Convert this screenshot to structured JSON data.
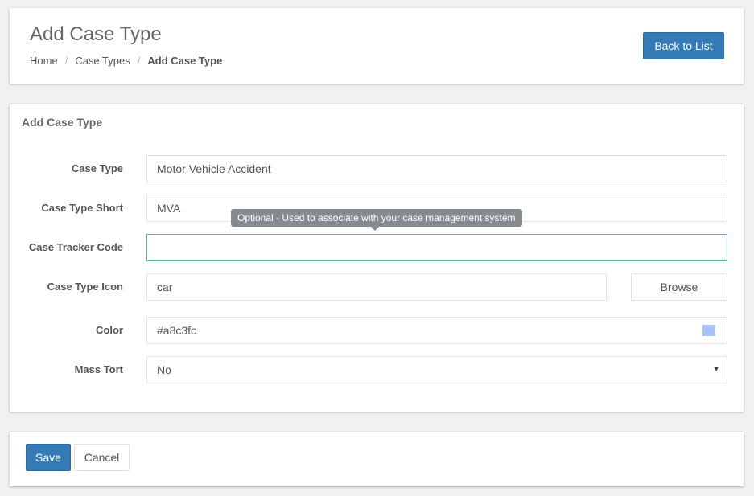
{
  "header": {
    "title": "Add Case Type",
    "back_label": "Back to List",
    "breadcrumb": [
      "Home",
      "Case Types",
      "Add Case Type"
    ]
  },
  "form": {
    "title": "Add Case Type",
    "fields": {
      "case_type": {
        "label": "Case Type",
        "value": "Motor Vehicle Accident"
      },
      "case_type_short": {
        "label": "Case Type Short",
        "value": "MVA"
      },
      "tracker_code": {
        "label": "Case Tracker Code",
        "value": ""
      },
      "icon": {
        "label": "Case Type Icon",
        "value": "car",
        "browse_label": "Browse"
      },
      "color": {
        "label": "Color",
        "value": "#a8c3fc"
      },
      "mass_tort": {
        "label": "Mass Tort",
        "value": "No"
      }
    },
    "tooltip": "Optional - Used to associate with your case management system"
  },
  "actions": {
    "save_label": "Save",
    "cancel_label": "Cancel"
  },
  "colors": {
    "primary": "#337ab7",
    "swatch": "#a8c3fc",
    "focus_border": "#5bb89e",
    "tooltip_bg": "#868b90"
  },
  "icons": {
    "select_arrow": "caret-down-icon"
  }
}
